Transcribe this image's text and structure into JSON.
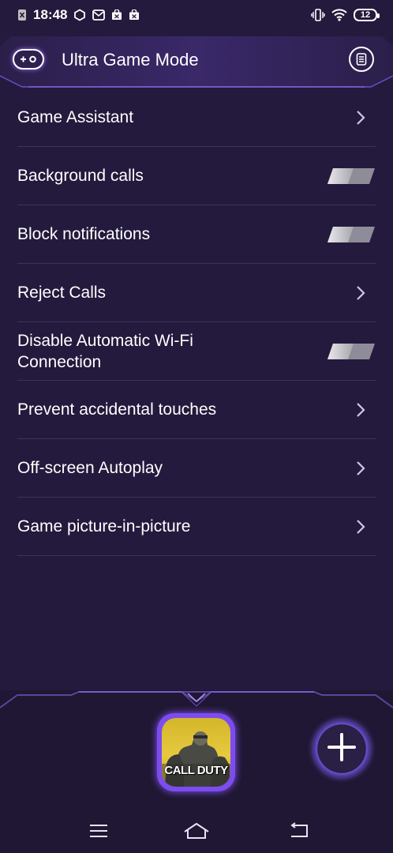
{
  "status_bar": {
    "time": "18:48",
    "battery": "12",
    "icons_left": [
      "sim-off-icon",
      "hexagon-icon",
      "mail-icon",
      "shopping-bag-icon",
      "shopping-bag-icon"
    ],
    "icons_right": [
      "vibrate-icon",
      "wifi-icon",
      "battery-icon"
    ]
  },
  "header": {
    "title": "Ultra Game Mode",
    "left_icon": "gamepad-icon",
    "right_icon": "document-icon"
  },
  "settings": [
    {
      "label": "Game Assistant",
      "control": "chevron"
    },
    {
      "label": "Background calls",
      "control": "toggle",
      "state": "off"
    },
    {
      "label": "Block notifications",
      "control": "toggle",
      "state": "off"
    },
    {
      "label": "Reject Calls",
      "control": "chevron"
    },
    {
      "label": "Disable Automatic Wi-Fi Connection",
      "control": "toggle",
      "state": "off"
    },
    {
      "label": "Prevent accidental touches",
      "control": "chevron"
    },
    {
      "label": "Off-screen Autoplay",
      "control": "chevron"
    },
    {
      "label": "Game picture-in-picture",
      "control": "chevron"
    }
  ],
  "dock": {
    "game_label": "CALL DUTY",
    "add_icon": "plus-icon"
  },
  "nav": {
    "icons": [
      "menu-icon",
      "home-icon",
      "back-icon"
    ]
  },
  "colors": {
    "background": "#241a3d",
    "accent": "#8a55ff",
    "divider": "#3d3260"
  }
}
